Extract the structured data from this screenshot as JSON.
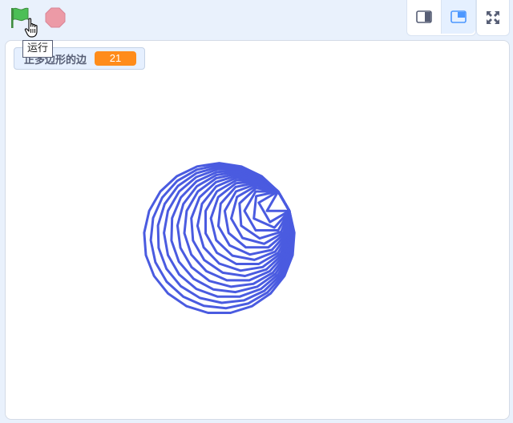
{
  "toolbar": {
    "run_tooltip": "运行"
  },
  "monitor": {
    "label": "正多边形的边",
    "value": "21"
  },
  "colors": {
    "pen": "#4a5be0",
    "monitor_value_bg": "#ff8c1a",
    "flag_green": "#4cbf56",
    "stop_red": "#ec9aa6"
  },
  "icons": {
    "green_flag": "green-flag-icon",
    "stop": "stop-icon",
    "small_stage": "small-stage-icon",
    "normal_stage": "normal-stage-icon",
    "fullscreen": "fullscreen-icon",
    "cursor": "hand-pointer-icon"
  }
}
